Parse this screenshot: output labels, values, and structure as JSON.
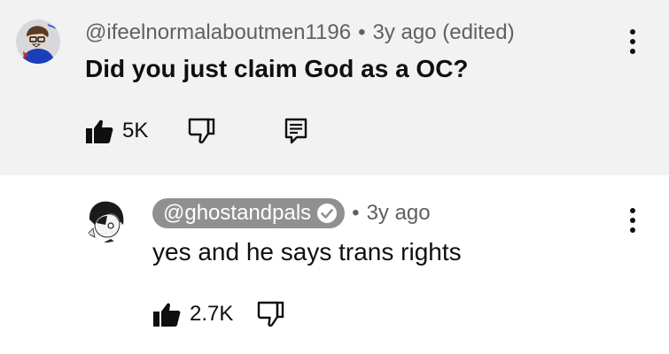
{
  "comments": [
    {
      "author": "@ifeelnormalaboutmen1196",
      "time": "3y ago (edited)",
      "text": "Did you just claim God as a OC?",
      "likes": "5K"
    },
    {
      "author": "@ghostandpals",
      "time": "3y ago",
      "text": "yes and he says trans rights",
      "likes": "2.7K"
    }
  ],
  "separator": "•",
  "icons": {
    "like": "thumbs-up-icon",
    "dislike": "thumbs-down-icon",
    "reply": "reply-comment-icon",
    "menu": "more-vert-icon",
    "verified": "verified-check-icon"
  },
  "colors": {
    "highlighted_bg": "#f2f2f2",
    "meta_text": "#606060",
    "creator_pill": "#909090"
  }
}
